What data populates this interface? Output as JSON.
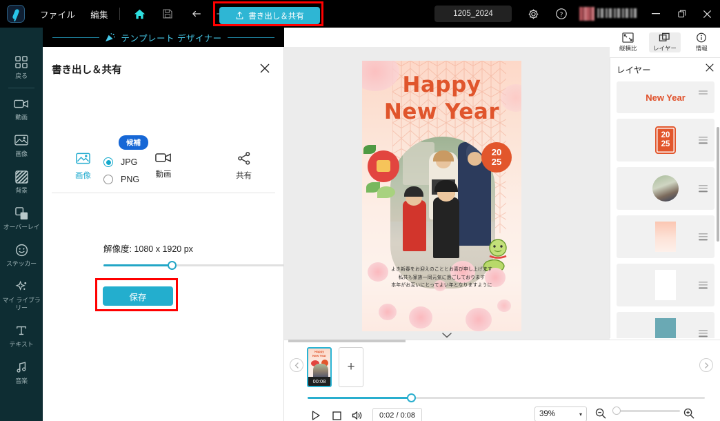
{
  "topbar": {
    "menus": [
      "ファイル",
      "編集"
    ],
    "icons": [
      {
        "name": "home-icon",
        "label": "ホーム"
      },
      {
        "name": "save-disk-icon",
        "label": "保存"
      },
      {
        "name": "undo-icon",
        "label": "元に戻す"
      },
      {
        "name": "redo-icon",
        "label": "やり直す"
      }
    ],
    "export_button": "書き出し＆共有",
    "filename": "1205_2024",
    "settings_icon": "gear-icon",
    "help_icon": "help-circle-icon",
    "window": {
      "minimize": "—",
      "restore": "❐",
      "close": "✕"
    }
  },
  "band": {
    "title": "テンプレート デザイナー"
  },
  "rail": {
    "items": [
      {
        "label": "戻る",
        "icon": "grid-back-icon"
      },
      {
        "label": "動画",
        "icon": "video-camera-icon"
      },
      {
        "label": "画像",
        "icon": "image-icon"
      },
      {
        "label": "背景",
        "icon": "background-hatch-icon"
      },
      {
        "label": "オーバーレイ",
        "icon": "overlay-layers-icon"
      },
      {
        "label": "ステッカー",
        "icon": "sticker-smiley-icon"
      },
      {
        "label": "マイ ライブラリー",
        "icon": "sparkle-icon"
      },
      {
        "label": "テキスト",
        "icon": "text-t-icon"
      },
      {
        "label": "音楽",
        "icon": "music-note-icon"
      }
    ]
  },
  "panel": {
    "title": "書き出し＆共有",
    "close_icon": "close-icon",
    "badge": "候補",
    "tabs": [
      {
        "label": "画像",
        "icon": "image-export-icon",
        "active": true
      },
      {
        "label": "動画",
        "icon": "video-export-icon",
        "active": false
      },
      {
        "label": "共有",
        "icon": "share-node-icon",
        "active": false
      }
    ],
    "formats": [
      {
        "label": "JPG",
        "selected": true
      },
      {
        "label": "PNG",
        "selected": false
      }
    ],
    "resolution": "解像度: 1080 x 1920 px",
    "quality_slider": {
      "percent": 33
    },
    "save_button": "保存"
  },
  "canvas": {
    "card": {
      "heading_line1": "Happy",
      "heading_line2": "New Year",
      "year_top": "20",
      "year_bottom": "25",
      "message_lines": [
        "よき新春をお迎えのこととお喜び申し上げます",
        "私共も家族一同元気に過ごしております",
        "本年がお互いにとってよい年となりますように"
      ]
    },
    "collapse_icon": "chevron-down-icon"
  },
  "layers": {
    "toolbar": [
      {
        "label": "縦横比",
        "icon": "aspect-ratio-icon",
        "selected": false
      },
      {
        "label": "レイヤー",
        "icon": "layers-icon",
        "selected": true
      },
      {
        "label": "情報",
        "icon": "info-circle-icon",
        "selected": false
      }
    ],
    "title": "レイヤー",
    "close_icon": "close-icon",
    "items": [
      {
        "type": "text",
        "label": "New Year",
        "color": "#e0502a"
      },
      {
        "type": "badge",
        "label_top": "20",
        "label_bottom": "25",
        "color": "#e2562c"
      },
      {
        "type": "photo",
        "label": ""
      },
      {
        "type": "gradient",
        "label": ""
      },
      {
        "type": "white",
        "label": ""
      },
      {
        "type": "teal",
        "label": ""
      }
    ]
  },
  "bottom": {
    "prev_icon": "chevron-left-icon",
    "next_icon": "chevron-right-icon",
    "clip": {
      "duration": "00:08",
      "mini_line1": "Happy",
      "mini_line2": "New Year"
    },
    "add_clip": "+",
    "play_icon": "play-icon",
    "stop_icon": "stop-icon",
    "volume_icon": "volume-icon",
    "timecode": "0:02 / 0:08",
    "zoom_value": "39%",
    "zoom_caret": "▾",
    "zoom_out_icon": "zoom-out-icon",
    "zoom_in_icon": "zoom-in-icon"
  },
  "colors": {
    "accent": "#29b4d4",
    "highlight": "#ff0000",
    "brand_dark": "#0e2d33",
    "card_orange": "#e0552c",
    "badge_blue": "#1667d6"
  }
}
